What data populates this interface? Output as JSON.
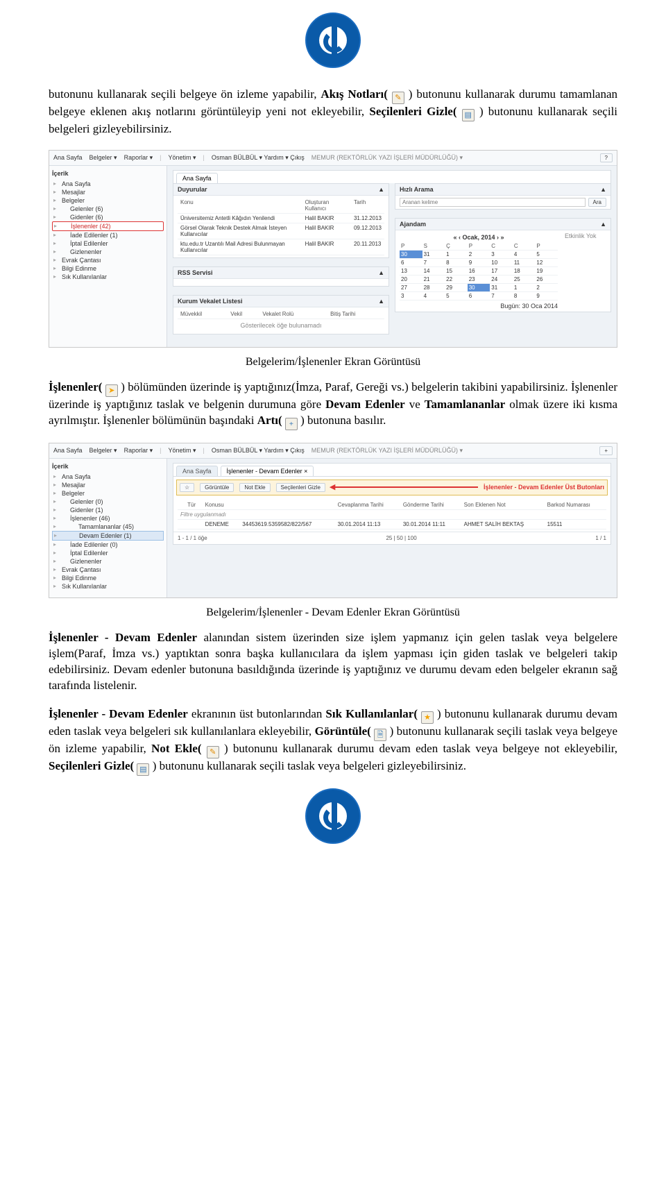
{
  "logo_alt": "Karadeniz Teknik Üniversitesi",
  "para1": {
    "t1": "butonunu kullanarak seçili belgeye ön izleme yapabilir, ",
    "b1": "Akış Notları(",
    "t2": " ) butonunu kullanarak durumu tamamlanan belgeye eklenen akış notlarını görüntüleyip yeni not ekleyebilir, ",
    "b2": "Seçilenleri Gizle(",
    "t3": ") butonunu kullanarak seçili belgeleri gizleyebilirsiniz."
  },
  "caption1": "Belgelerim/İşlenenler Ekran Görüntüsü",
  "para2": {
    "b1": "İşlenenler(",
    "t1": " ) bölümünden üzerinde iş yaptığınız(İmza, Paraf, Gereği vs.) belgelerin takibini yapabilirsiniz. İşlenenler üzerinde iş yaptığınız taslak ve belgenin durumuna göre ",
    "b2": "Devam Edenler",
    "t2": " ve ",
    "b3": "Tamamlananlar",
    "t3": " olmak üzere iki kısma ayrılmıştır. İşlenenler bölümünün başındaki ",
    "b4": "Artı(",
    "t4": " ) butonuna basılır."
  },
  "caption2": "Belgelerim/İşlenenler - Devam Edenler Ekran Görüntüsü",
  "para3": {
    "b1": "İşlenenler - Devam Edenler",
    "t1": " alanından sistem üzerinden size işlem yapmanız için gelen taslak veya belgelere işlem(Paraf, İmza vs.) yaptıktan sonra başka kullanıcılara da işlem yapması için giden taslak ve belgeleri takip edebilirsiniz. Devam edenler butonuna basıldığında üzerinde iş yaptığınız ve durumu devam eden belgeler ekranın sağ tarafında listelenir."
  },
  "para4": {
    "b1": "İşlenenler - Devam Edenler",
    "t1": " ekranının üst butonlarından ",
    "b2": "Sık Kullanılanlar(",
    "t2": " ) butonunu kullanarak durumu devam eden taslak veya belgeleri sık kullanılanlara ekleyebilir, ",
    "b3": "Görüntüle(",
    "t3": " ) butonunu kullanarak seçili taslak veya belgeye ön izleme yapabilir, ",
    "b4": "Not Ekle(",
    "t4": " ) butonunu kullanarak durumu devam eden taslak veya belgeye not ekleyebilir, ",
    "b5": "Seçilenleri Gizle(",
    "t5": " ) butonunu kullanarak seçili taslak veya belgeleri gizleyebilirsiniz."
  },
  "shot1": {
    "menu": [
      "Ana Sayfa",
      "Belgeler ▾",
      "Raporlar ▾",
      "Yönetim ▾"
    ],
    "user": "Osman BÜLBÜL ▾   Yardım ▾   Çıkış",
    "role": "MEMUR (REKTÖRLÜK YAZI İŞLERİ MÜDÜRLÜĞÜ) ▾",
    "side_hdr": "İçerik",
    "tree": [
      {
        "t": "Ana Sayfa",
        "c": "node"
      },
      {
        "t": "Mesajlar",
        "c": "node"
      },
      {
        "t": "Belgeler",
        "c": "node"
      },
      {
        "t": "Gelenler (6)",
        "c": "node sub"
      },
      {
        "t": "Gidenler (6)",
        "c": "node sub"
      },
      {
        "t": "İşlenenler (42)",
        "c": "node sub sel"
      },
      {
        "t": "İade Edilenler (1)",
        "c": "node sub"
      },
      {
        "t": "İptal Edilenler",
        "c": "node sub"
      },
      {
        "t": "Gizlenenler",
        "c": "node sub"
      },
      {
        "t": "Evrak Çantası",
        "c": "node"
      },
      {
        "t": "Bilgi Edinme",
        "c": "node"
      },
      {
        "t": "Sık Kullanılanlar",
        "c": "node"
      }
    ],
    "tab": "Ana Sayfa",
    "duyurular": {
      "title": "Duyurular",
      "cols": [
        "Konu",
        "Oluşturan Kullanıcı",
        "Tarih"
      ],
      "rows": [
        [
          "Üniversitemiz Antetli Kâğıdın Yenilendi",
          "Halil BAKIR",
          "31.12.2013"
        ],
        [
          "Görsel Olarak Teknik Destek Almak İsteyen Kullanıcılar",
          "Halil BAKIR",
          "09.12.2013"
        ],
        [
          "ktu.edu.tr Uzantılı Mail Adresi Bulunmayan Kullanıcılar",
          "Halil BAKIR",
          "20.11.2013"
        ]
      ]
    },
    "rss": "RSS Servisi",
    "vekalet": {
      "title": "Kurum Vekalet Listesi",
      "cols": [
        "Müvekkil",
        "Vekil",
        "Vekalet Rolü",
        "Bitiş Tarihi"
      ],
      "empty": "Gösterilecek öğe bulunamadı"
    },
    "hizli": {
      "title": "Hızlı Arama",
      "placeholder": "Aranan kelime",
      "btn": "Ara"
    },
    "ajandam": {
      "title": "Ajandam",
      "month": "Ocak, 2014",
      "days": [
        "P",
        "S",
        "Ç",
        "P",
        "C",
        "C",
        "P"
      ],
      "weeks": [
        [
          "30",
          "31",
          "1",
          "2",
          "3",
          "4",
          "5"
        ],
        [
          "6",
          "7",
          "8",
          "9",
          "10",
          "11",
          "12"
        ],
        [
          "13",
          "14",
          "15",
          "16",
          "17",
          "18",
          "19"
        ],
        [
          "20",
          "21",
          "22",
          "23",
          "24",
          "25",
          "26"
        ],
        [
          "27",
          "28",
          "29",
          "30",
          "31",
          "1",
          "2"
        ],
        [
          "3",
          "4",
          "5",
          "6",
          "7",
          "8",
          "9"
        ]
      ],
      "today": "30",
      "note": "Etkinlik Yok",
      "foot": "Bugün: 30 Oca 2014"
    }
  },
  "shot2": {
    "menu": [
      "Ana Sayfa",
      "Belgeler ▾",
      "Raporlar ▾",
      "Yönetim ▾"
    ],
    "user": "Osman BÜLBÜL ▾   Yardım ▾   Çıkış",
    "role": "MEMUR (REKTÖRLÜK YAZI İŞLERİ MÜDÜRLÜĞÜ) ▾",
    "side_hdr": "İçerik",
    "tree": [
      {
        "t": "Ana Sayfa",
        "c": "node"
      },
      {
        "t": "Mesajlar",
        "c": "node"
      },
      {
        "t": "Belgeler",
        "c": "node"
      },
      {
        "t": "Gelenler (0)",
        "c": "node sub"
      },
      {
        "t": "Gidenler (1)",
        "c": "node sub"
      },
      {
        "t": "İşlenenler (46)",
        "c": "node sub"
      },
      {
        "t": "Tamamlananlar (45)",
        "c": "node sub2"
      },
      {
        "t": "Devam Edenler (1)",
        "c": "node sub2 sel2"
      },
      {
        "t": "İade Edilenler (0)",
        "c": "node sub"
      },
      {
        "t": "İptal Edilenler",
        "c": "node sub"
      },
      {
        "t": "Gizlenenler",
        "c": "node sub"
      },
      {
        "t": "Evrak Çantası",
        "c": "node"
      },
      {
        "t": "Bilgi Edinme",
        "c": "node"
      },
      {
        "t": "Sık Kullanılanlar",
        "c": "node"
      }
    ],
    "tabs": [
      "Ana Sayfa",
      "İşlenenler - Devam Edenler  ×"
    ],
    "toolbar": [
      "☆",
      "Görüntüle",
      "Not Ekle",
      "Seçilenleri Gizle"
    ],
    "redlabel": "İşlenenler - Devam Edenler Üst Butonları",
    "grid": {
      "cols": [
        "",
        "Tür",
        "Konusu",
        "",
        "Cevaplanma Tarihi",
        "Gönderme Tarihi",
        "Son Eklenen Not",
        "Barkod Numarası"
      ],
      "filter": "Filtre uygulanmadı",
      "rows": [
        [
          "",
          "",
          "DENEME",
          "34453619.5359582/822/567",
          "30.01.2014 11:13",
          "30.01.2014 11:11",
          "AHMET SALİH BEKTAŞ",
          "15511"
        ]
      ]
    },
    "pager": {
      "left": "1 - 1 / 1 öğe",
      "mid": "25 | 50 | 100",
      "right": "1 / 1"
    }
  }
}
